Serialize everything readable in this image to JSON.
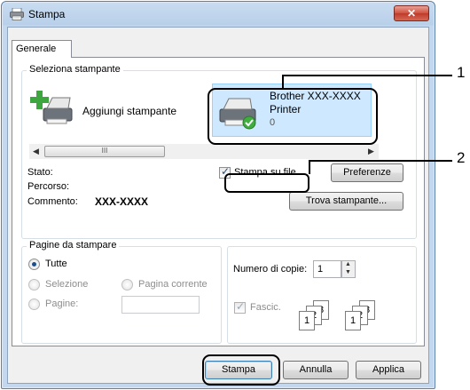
{
  "window": {
    "title": "Stampa",
    "close_label": "✕"
  },
  "tabs": [
    {
      "label": "Generale",
      "active": true
    }
  ],
  "select_printer": {
    "legend": "Seleziona stampante",
    "add_printer_label": "Aggiungi stampante",
    "printer_name_line1": "Brother XXX-XXXX",
    "printer_name_line2": "Printer",
    "printer_count": "0",
    "scroll_thumb_label": "III",
    "status_label": "Stato:",
    "location_label": "Percorso:",
    "comment_label": "Commento:",
    "comment_value": "XXX-XXXX",
    "print_to_file_label": "Stampa su file",
    "print_to_file_checked": true,
    "preferences_button": "Preferenze",
    "find_printer_button": "Trova stampante..."
  },
  "page_range": {
    "legend": "Pagine da stampare",
    "all_label": "Tutte",
    "selection_label": "Selezione",
    "current_page_label": "Pagina corrente",
    "pages_label": "Pagine:",
    "pages_value": ""
  },
  "copies": {
    "number_label": "Numero di copie:",
    "number_value": "1",
    "collate_label": "Fascic.",
    "collate_checked": true
  },
  "buttons": {
    "print": "Stampa",
    "cancel": "Annulla",
    "apply": "Applica"
  },
  "callouts": {
    "one": "1",
    "two": "2"
  }
}
